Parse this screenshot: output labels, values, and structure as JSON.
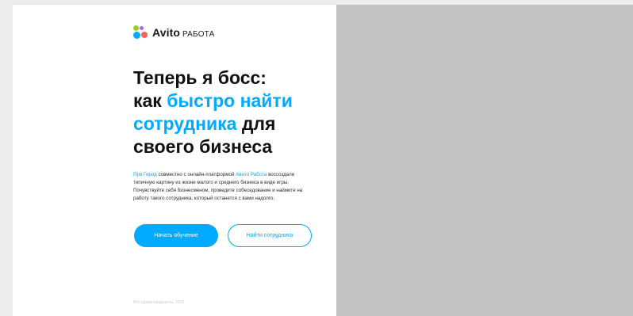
{
  "logo": {
    "brand": "Avito",
    "sub": "РАБОТА",
    "colors": [
      "#97cf26",
      "#a169f7",
      "#00aaff",
      "#ff6163"
    ]
  },
  "headline": {
    "line1": "Теперь я босс:",
    "line2_prefix": "как ",
    "line2_accent": "быстро найти",
    "line3_accent": "сотрудника",
    "line3_suffix": " для",
    "line4": "своего бизнеса"
  },
  "description": {
    "link1": "Про Город",
    "text1": " совместно с онлайн-платформой ",
    "link2": "Авито Работа",
    "text2": " воссоздали типичную картину из жизни малого и среднего бизнеса в виде игры. Почувствуйте себя бизнесменом, проведите собеседование и наймите на работу такого сотрудника, который останется с вами надолго."
  },
  "buttons": {
    "start": "Начать обучение",
    "find": "Найти сотрудника"
  },
  "footer": {
    "text": "Все права защищены, 2022"
  },
  "colors": {
    "accent": "#00aaff",
    "right_panel": "#c3c3c3"
  }
}
